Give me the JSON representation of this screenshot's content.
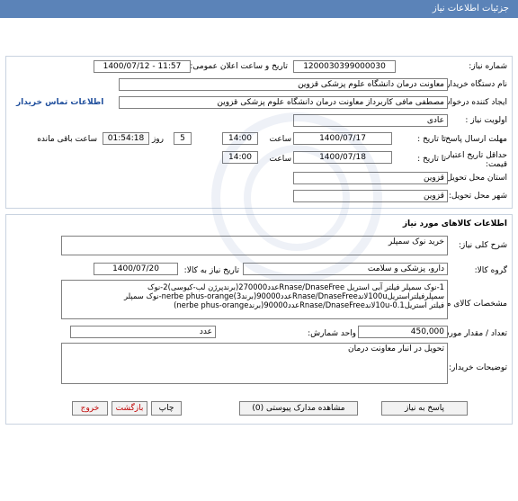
{
  "header": {
    "title": "جزئیات اطلاعات نیاز"
  },
  "fields": {
    "need_number_label": "شماره نیاز:",
    "need_number": "1200030399000030",
    "announce_label": "تاریخ و ساعت اعلان عمومی:",
    "announce_value": "1400/07/12 - 11:57",
    "buyer_label": "نام دستگاه خریدار:",
    "buyer_value": "معاونت درمان دانشگاه علوم پزشکی قزوین",
    "creator_label": "ایجاد کننده درخواست:",
    "creator_value": "مصطفی مافی کاربرداز معاونت درمان دانشگاه علوم پزشکی قزوین",
    "contact_link": "اطلاعات تماس خریدار",
    "priority_label": "اولویت نیاز :",
    "priority_value": "عادی",
    "deadline_label": "مهلت ارسال پاسخ:",
    "to_date_label": "تا تاریخ :",
    "deadline_date": "1400/07/17",
    "time_label": "ساعت",
    "deadline_time": "14:00",
    "days_value": "5",
    "days_label": "روز و",
    "remaining_time": "01:54:18",
    "remaining_label": "ساعت باقی مانده",
    "validity_label": "حداقل تاریخ اعتبار قیمت:",
    "validity_to_label": "تا تاریخ :",
    "validity_date": "1400/07/18",
    "validity_time_label": "ساعت",
    "validity_time": "14:00",
    "province_label": "استان محل تحویل:",
    "province_value": "قزوین",
    "city_label": "شهر محل تحویل:",
    "city_value": "قزوین"
  },
  "goods": {
    "section_title": "اطلاعات کالاهای مورد نیاز",
    "summary_label": "شرح کلی نیاز:",
    "summary_value": "خرید نوک سمپلر",
    "group_label": "گروه کالا:",
    "group_value": "دارو، پزشکی و سلامت",
    "need_date_label": "تاریخ نیاز به کالا:",
    "need_date": "1400/07/20",
    "specs_label": "مشخصات کالای مورد نیاز:",
    "specs_line1": "1-نوک سمپلر فیلتر آبی استریل Rnase/DnaseFreeعدد270000(برندپرژن لب-کیوسی)2-نوک",
    "specs_line2": "سمپلرفیلتراستریل100uلاندRnase/DnaseFreeعدد90000(برند3)nerbe phus-orange-نوک سمپلر",
    "specs_line3": "فیلتر استریل0.1-10uلاندRnase/DnaseFreeعدد90000(برندnerbe phus-orange)",
    "qty_label": "تعداد / مقدار مورد نیاز:",
    "qty_value": "450,000",
    "unit_label": "واحد شمارش:",
    "unit_value": "عدد",
    "notes_label": "توضیحات خریدار:",
    "notes_value": "تحویل در انبار معاونت درمان"
  },
  "buttons": {
    "reply": "پاسخ به نیاز",
    "attachments": "مشاهده مدارک پیوستی (0)",
    "print": "چاپ",
    "back": "بازگشت",
    "exit": "خروج"
  }
}
